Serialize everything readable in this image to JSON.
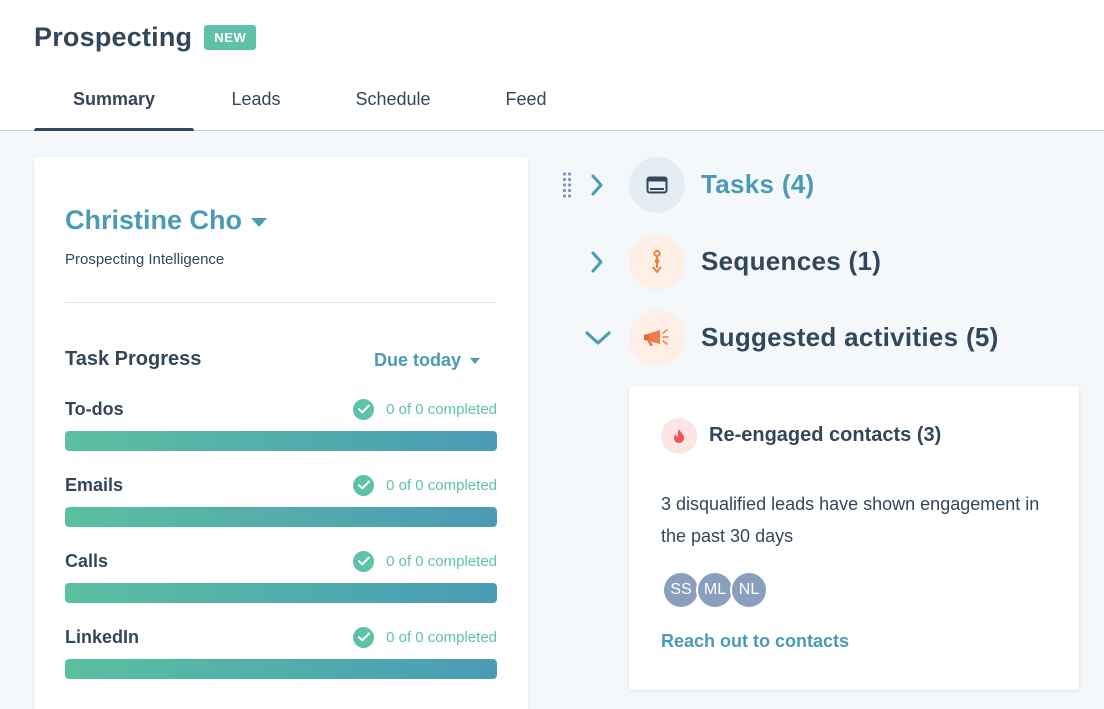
{
  "header": {
    "title": "Prospecting",
    "badge": "NEW",
    "tabs": [
      {
        "label": "Summary",
        "active": true
      },
      {
        "label": "Leads",
        "active": false
      },
      {
        "label": "Schedule",
        "active": false
      },
      {
        "label": "Feed",
        "active": false
      }
    ]
  },
  "summary": {
    "owner_name": "Christine Cho",
    "owner_subtitle": "Prospecting Intelligence",
    "progress_title": "Task Progress",
    "due_filter": "Due today",
    "items": [
      {
        "label": "To-dos",
        "status": "0 of 0 completed",
        "fill_percent": 100
      },
      {
        "label": "Emails",
        "status": "0 of 0 completed",
        "fill_percent": 100
      },
      {
        "label": "Calls",
        "status": "0 of 0 completed",
        "fill_percent": 100
      },
      {
        "label": "LinkedIn",
        "status": "0 of 0 completed",
        "fill_percent": 100
      }
    ]
  },
  "sections": {
    "tasks": {
      "title": "Tasks (4)",
      "icon": "window-icon",
      "expanded": false
    },
    "sequences": {
      "title": "Sequences (1)",
      "icon": "sequence-icon",
      "expanded": false
    },
    "suggested": {
      "title": "Suggested activities (5)",
      "icon": "megaphone-icon",
      "expanded": true
    }
  },
  "activity_card": {
    "title": "Re-engaged contacts (3)",
    "icon": "flame-icon",
    "description": "3 disqualified leads have shown engagement in the past 30 days",
    "avatars": [
      "SS",
      "ML",
      "NL"
    ],
    "link": "Reach out to contacts"
  },
  "colors": {
    "accent": "#4a9bb5",
    "success": "#5ec2a9",
    "text": "#33475b",
    "orange": "#f07f4a",
    "avatar": "#8a9fbd"
  }
}
